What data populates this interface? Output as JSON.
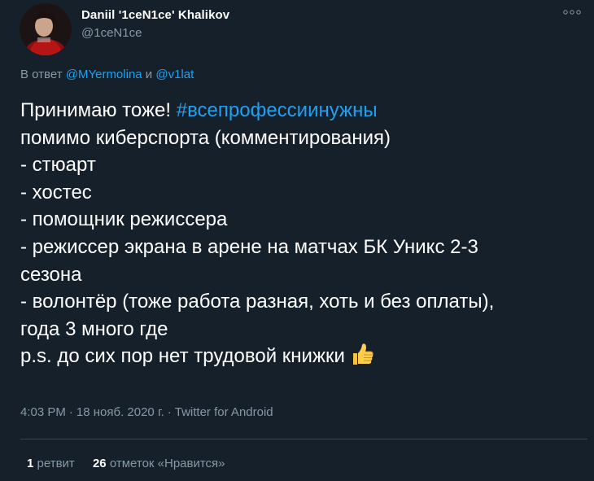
{
  "author": {
    "display_name": "Daniil '1ceN1ce' Khalikov",
    "handle": "@1ceN1ce"
  },
  "reply": {
    "prefix": "В ответ",
    "mention_1": "@MYermolina",
    "conjunction": "и",
    "mention_2": "@v1lat"
  },
  "tweet": {
    "line_1_text": "Принимаю тоже! ",
    "hashtag": "#всепрофессиинужны",
    "lines": [
      "помимо киберспорта (комментирования)",
      "- стюарт",
      "- хостес",
      "- помощник режиссера",
      "- режиссер экрана в арене на матчах БК Уникс 2-3",
      "сезона",
      "- волонтёр (тоже работа разная, хоть и без оплаты),",
      "года 3 много где",
      "p.s. до сих пор нет трудовой книжки"
    ],
    "emoji": "thumbs-up-icon"
  },
  "meta": {
    "time": "4:03 PM",
    "date": "18 нояб. 2020 г.",
    "source": "Twitter for Android",
    "separator": "·"
  },
  "stats": {
    "retweets_count": "1",
    "retweets_label": "ретвит",
    "likes_count": "26",
    "likes_label": "отметок «Нравится»"
  },
  "colors": {
    "background": "#15202b",
    "accent": "#1da1f2",
    "secondary_text": "#8899a6",
    "divider": "#38444d"
  },
  "icons": {
    "more": "more-horizontal-icon",
    "avatar": "avatar"
  }
}
